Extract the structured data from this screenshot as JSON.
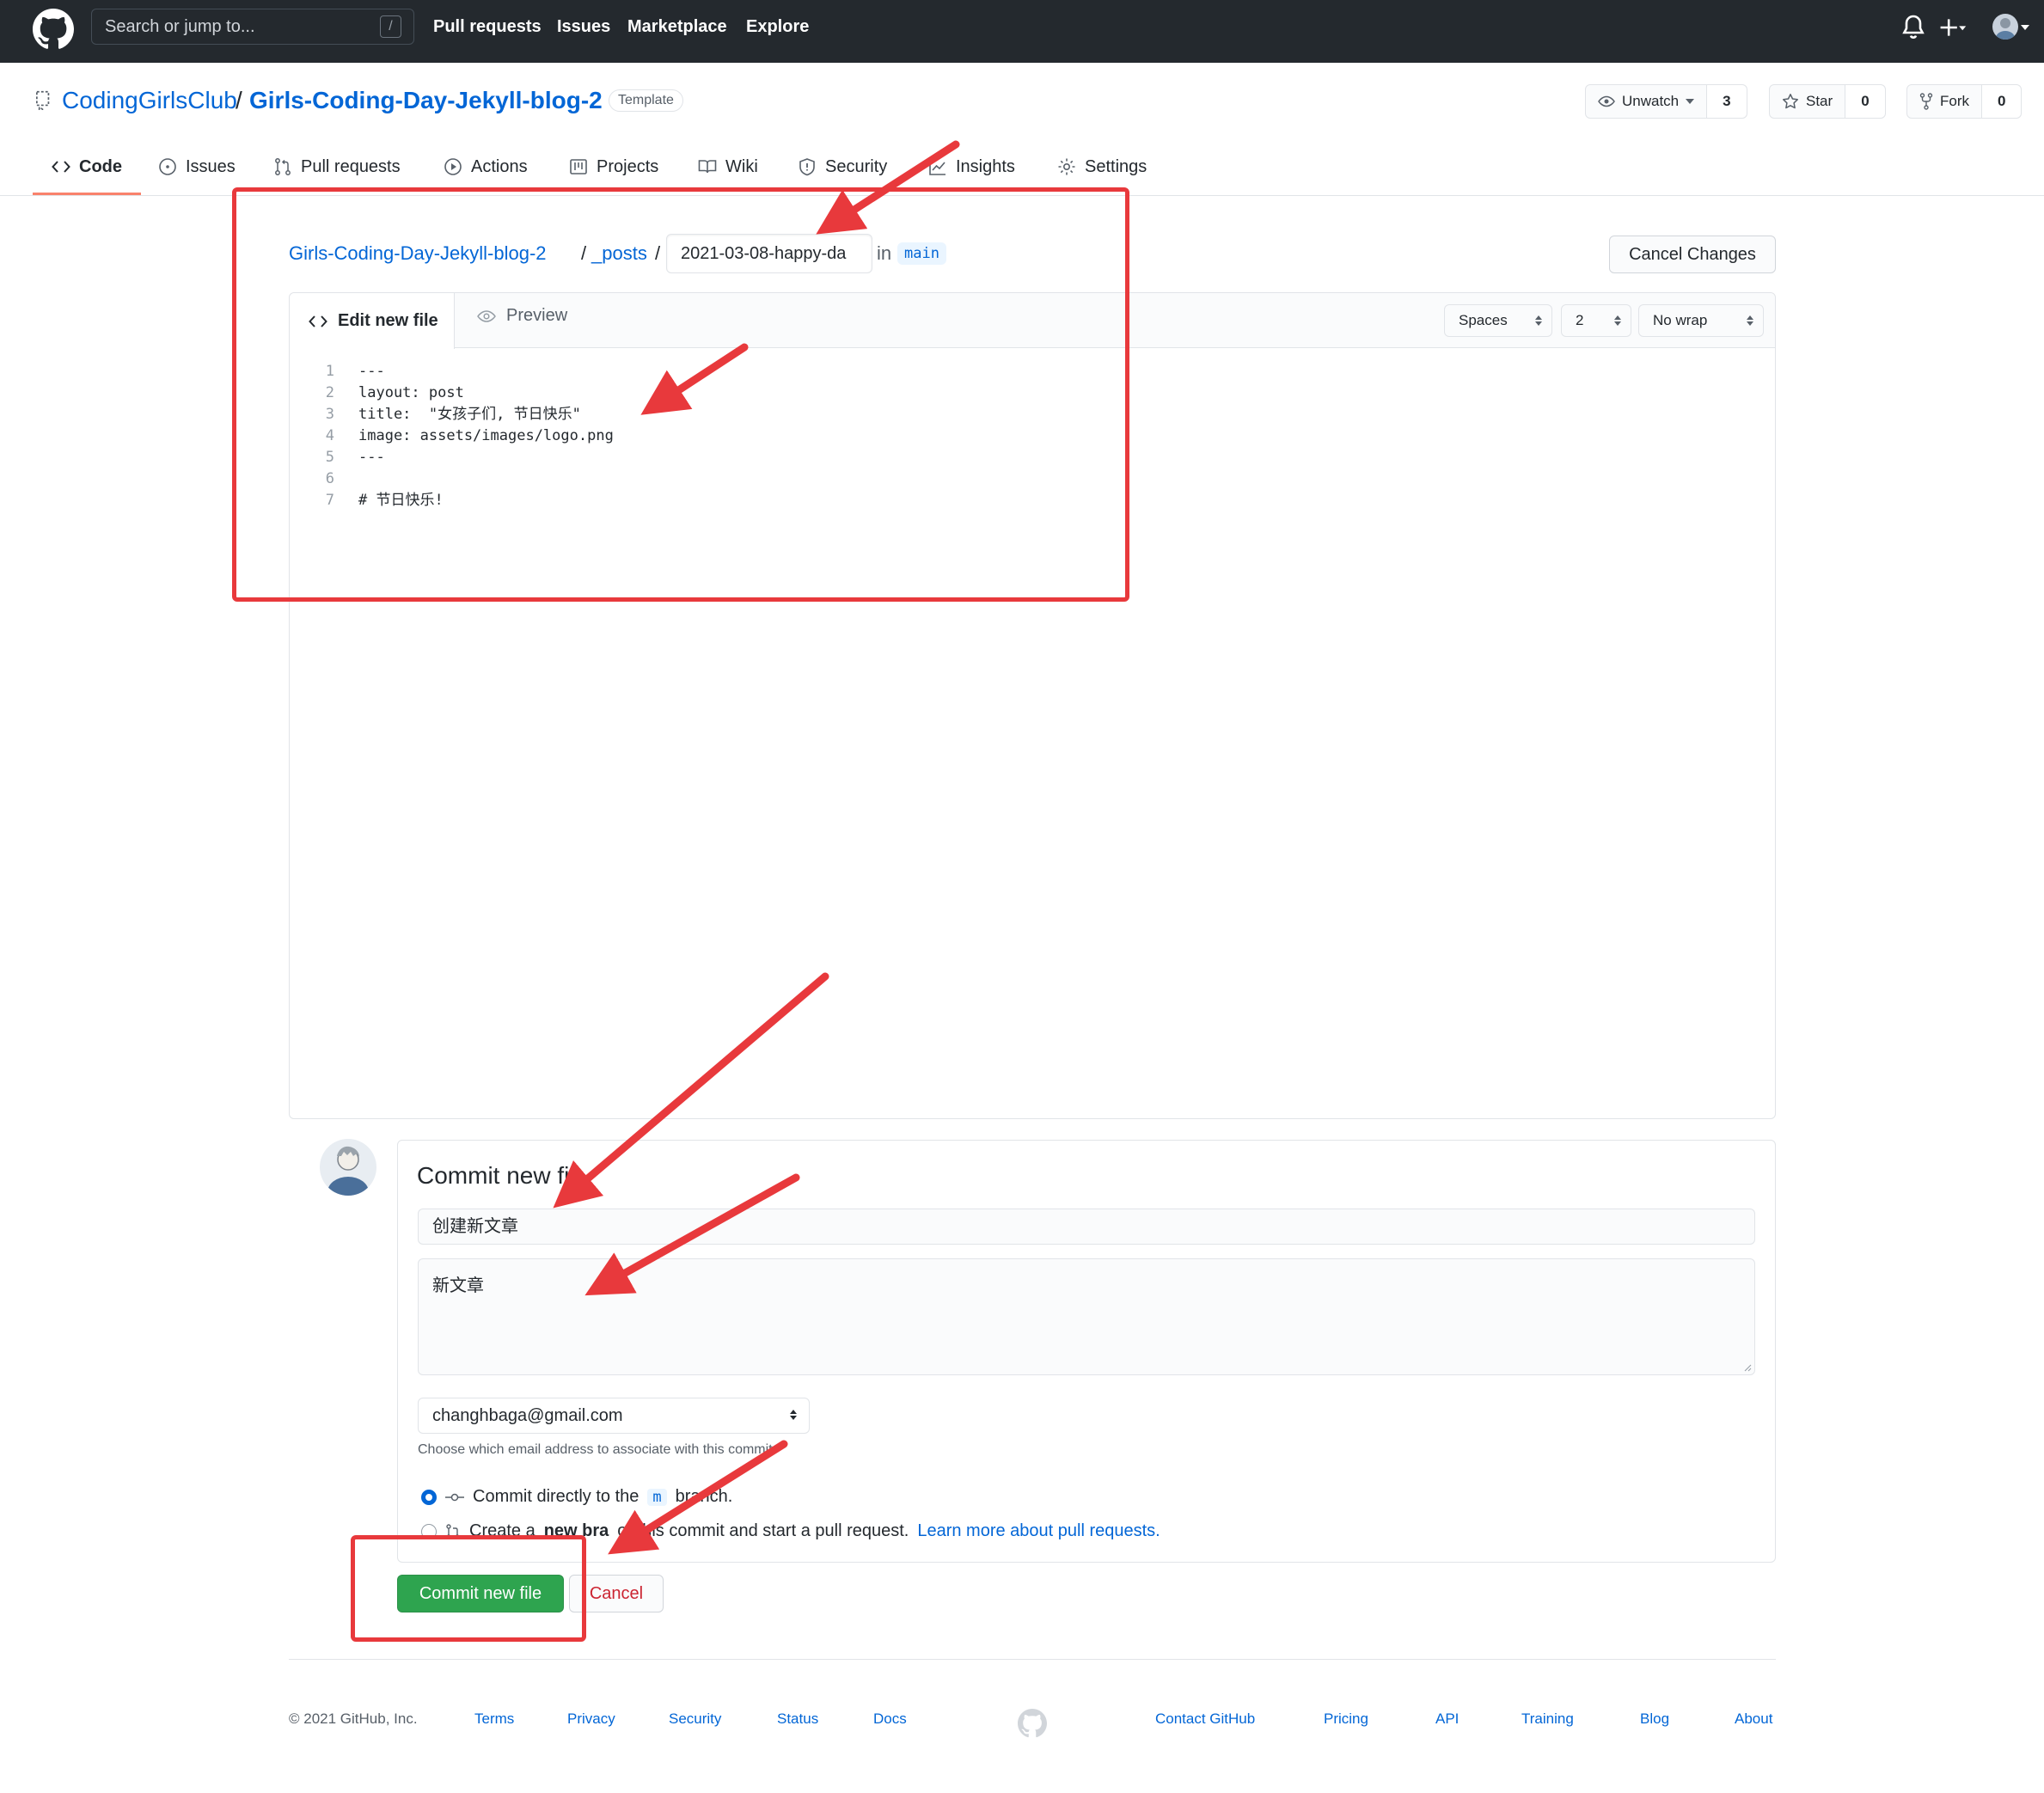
{
  "header": {
    "search_placeholder": "Search or jump to...",
    "slash_key": "/",
    "nav": [
      "Pull requests",
      "Issues",
      "Marketplace",
      "Explore"
    ]
  },
  "repo": {
    "owner": "CodingGirlsClub",
    "separator": "/",
    "name": "Girls-Coding-Day-Jekyll-blog-2",
    "badge": "Template",
    "unwatch_label": "Unwatch",
    "unwatch_count": "3",
    "star_label": "Star",
    "star_count": "0",
    "fork_label": "Fork",
    "fork_count": "0"
  },
  "tabs": [
    {
      "label": "Code",
      "icon": "code-icon",
      "active": true
    },
    {
      "label": "Issues",
      "icon": "issue-icon"
    },
    {
      "label": "Pull requests",
      "icon": "pull-request-icon"
    },
    {
      "label": "Actions",
      "icon": "play-icon"
    },
    {
      "label": "Projects",
      "icon": "project-icon"
    },
    {
      "label": "Wiki",
      "icon": "book-icon"
    },
    {
      "label": "Security",
      "icon": "shield-icon"
    },
    {
      "label": "Insights",
      "icon": "graph-icon"
    },
    {
      "label": "Settings",
      "icon": "gear-icon"
    }
  ],
  "breadcrumb": {
    "repo": "Girls-Coding-Day-Jekyll-blog-2",
    "sep1": "/",
    "folder": "_posts",
    "sep2": "/",
    "filename": "2021-03-08-happy-da",
    "in_text": "in",
    "branch": "main"
  },
  "cancel_changes": "Cancel Changes",
  "editor": {
    "tab_edit": "Edit new file",
    "tab_preview": "Preview",
    "indent_mode": "Spaces",
    "indent_size": "2",
    "wrap_mode": "No wrap",
    "lines": [
      {
        "n": "1",
        "text": "---"
      },
      {
        "n": "2",
        "text": "layout: post"
      },
      {
        "n": "3",
        "text": "title:  \"女孩子们, 节日快乐\""
      },
      {
        "n": "4",
        "text": "image: assets/images/logo.png"
      },
      {
        "n": "5",
        "text": "---"
      },
      {
        "n": "6",
        "text": ""
      },
      {
        "n": "7",
        "text": "# 节日快乐!"
      }
    ]
  },
  "commit": {
    "title": "Commit new fil",
    "message": "创建新文章",
    "description": "新文章",
    "email": "changhbaga@gmail.com",
    "email_hint": "Choose which email address to associate with this commit",
    "option1_pre": "Commit directly to the",
    "option1_code": "m",
    "option1_post": "branch.",
    "option2_pre": "Create a",
    "option2_bold": "new bra",
    "option2_post": "or this commit and start a pull request.",
    "option2_link": "Learn more about pull requests.",
    "commit_button": "Commit new file",
    "cancel_button": "Cancel"
  },
  "footer": {
    "copyright": "© 2021 GitHub, Inc.",
    "left_links": [
      "Terms",
      "Privacy",
      "Security",
      "Status",
      "Docs"
    ],
    "right_links": [
      "Contact GitHub",
      "Pricing",
      "API",
      "Training",
      "Blog",
      "About"
    ]
  },
  "colors": {
    "header_bg": "#24292e",
    "link": "#0366d6",
    "commit_green": "#2ea44f",
    "annotation_red": "#e8393c",
    "tab_accent": "#f9826c"
  }
}
